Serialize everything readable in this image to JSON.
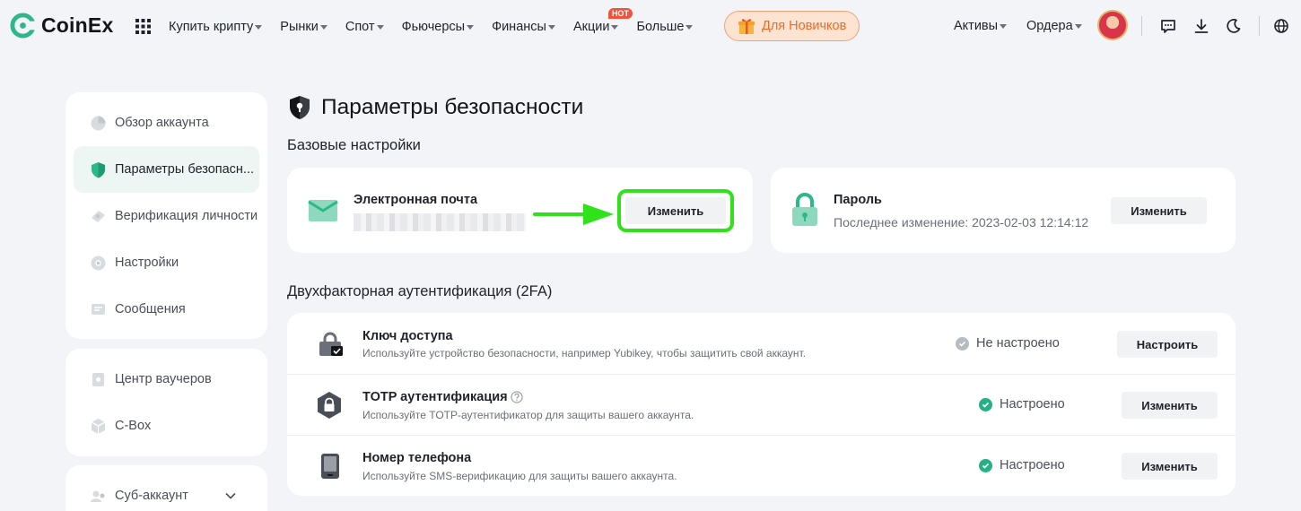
{
  "brand": {
    "name": "CoinEx",
    "accent": "#2eb88a",
    "highlight": "#2fe21a"
  },
  "nav": {
    "items": [
      {
        "label": "Купить крипту",
        "caret": true
      },
      {
        "label": "Рынки",
        "caret": true
      },
      {
        "label": "Спот",
        "caret": true
      },
      {
        "label": "Фьючерсы",
        "caret": true
      },
      {
        "label": "Финансы",
        "caret": true
      },
      {
        "label": "Акции",
        "caret": true,
        "badge": "HOT"
      },
      {
        "label": "Больше",
        "caret": true
      }
    ],
    "newbie_label": "Для Новичков",
    "assets_label": "Активы",
    "orders_label": "Ордера"
  },
  "sidebar": {
    "group1": [
      {
        "label": "Обзор аккаунта",
        "icon": "pie-chart-icon",
        "active": false
      },
      {
        "label": "Параметры безопасн...",
        "icon": "shield-icon",
        "active": true
      },
      {
        "label": "Верификация личности",
        "icon": "id-card-icon",
        "active": false
      },
      {
        "label": "Настройки",
        "icon": "gear-icon",
        "active": false
      },
      {
        "label": "Сообщения",
        "icon": "message-icon",
        "active": false
      }
    ],
    "group2": [
      {
        "label": "Центр ваучеров",
        "icon": "voucher-icon"
      },
      {
        "label": "C-Box",
        "icon": "box-icon"
      }
    ],
    "group3": [
      {
        "label": "Суб-аккаунт",
        "icon": "sub-account-icon"
      }
    ]
  },
  "page": {
    "title": "Параметры безопасности",
    "basic_title": "Базовые настройки",
    "twofa_title": "Двухфакторная аутентификация (2FA)"
  },
  "email_card": {
    "label": "Электронная почта",
    "button": "Изменить"
  },
  "password_card": {
    "label": "Пароль",
    "last_change": "Последнее изменение: 2023-02-03 12:14:12",
    "button": "Изменить"
  },
  "twofa_rows": [
    {
      "title": "Ключ доступа",
      "desc": "Используйте устройство безопасности, например Yubikey, чтобы защитить свой аккаунт.",
      "status": "Не настроено",
      "configured": false,
      "button": "Настроить"
    },
    {
      "title": "TOTP аутентификация",
      "desc": "Используйте TOTP-аутентификатор для защиты вашего аккаунта.",
      "status": "Настроено",
      "configured": true,
      "button": "Изменить"
    },
    {
      "title": "Номер телефона",
      "desc": "Используйте SMS-верификацию для защиты вашего аккаунта.",
      "status": "Настроено",
      "configured": true,
      "button": "Изменить"
    }
  ]
}
